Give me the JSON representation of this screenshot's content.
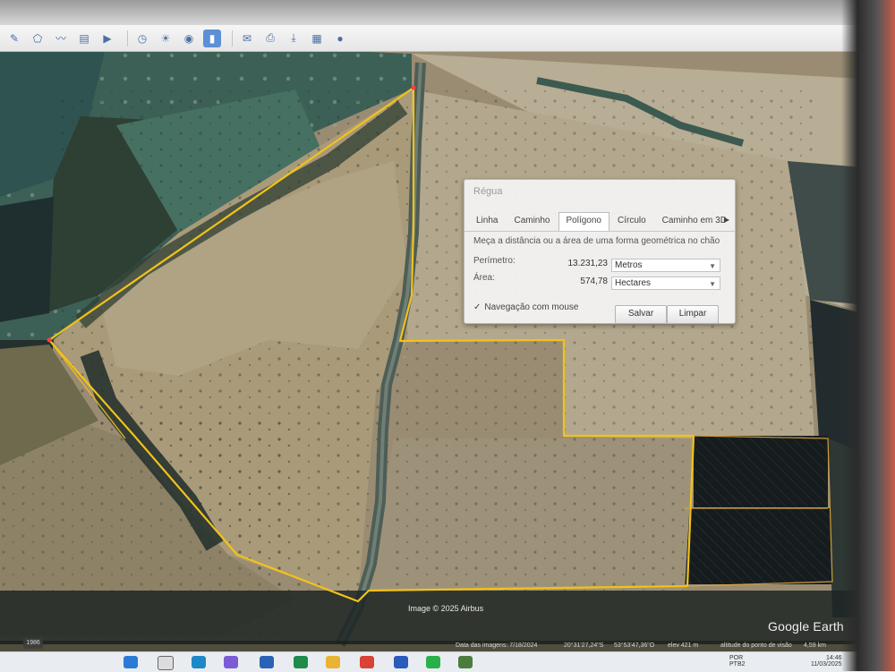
{
  "toolbar": {
    "icons": [
      "placemark-icon",
      "polygon-icon",
      "path-icon",
      "overlay-icon",
      "tour-icon",
      "historical-imagery-icon",
      "sun-icon",
      "planets-icon",
      "ruler-icon",
      "email-icon",
      "print-icon",
      "save-image-icon",
      "maps-icon",
      "web-icon"
    ]
  },
  "dialog": {
    "title": "Régua",
    "tabs": [
      "Linha",
      "Caminho",
      "Polígono",
      "Círculo",
      "Caminho em 3D"
    ],
    "active_tab": "Polígono",
    "description": "Meça a distância ou a área de uma forma geométrica no chão",
    "perimeter": {
      "label": "Perímetro:",
      "value": "13.231,23",
      "unit": "Metros"
    },
    "area": {
      "label": "Área:",
      "value": "574,78",
      "unit": "Hectares"
    },
    "mouse_nav": {
      "checked": true,
      "label": "Navegação com mouse"
    },
    "save_label": "Salvar",
    "clear_label": "Limpar"
  },
  "map": {
    "attribution": "Image © 2025 Airbus",
    "logo": "Google Earth",
    "scale_chip": "1986",
    "status": {
      "imagery_date": "Data das imagens: 7/18/2024",
      "lat": "20°31'27,24\"S",
      "lon": "53°53'47,36\"O",
      "elevation": "elev  421 m",
      "eye_altitude": "altitude do ponto de visão",
      "eye_value": "4,59 km"
    },
    "polygon_color": "#f2c21a"
  },
  "taskbar": {
    "language": "POR",
    "language_sub": "PTB2",
    "time": "14:46",
    "date": "11/03/2025"
  }
}
